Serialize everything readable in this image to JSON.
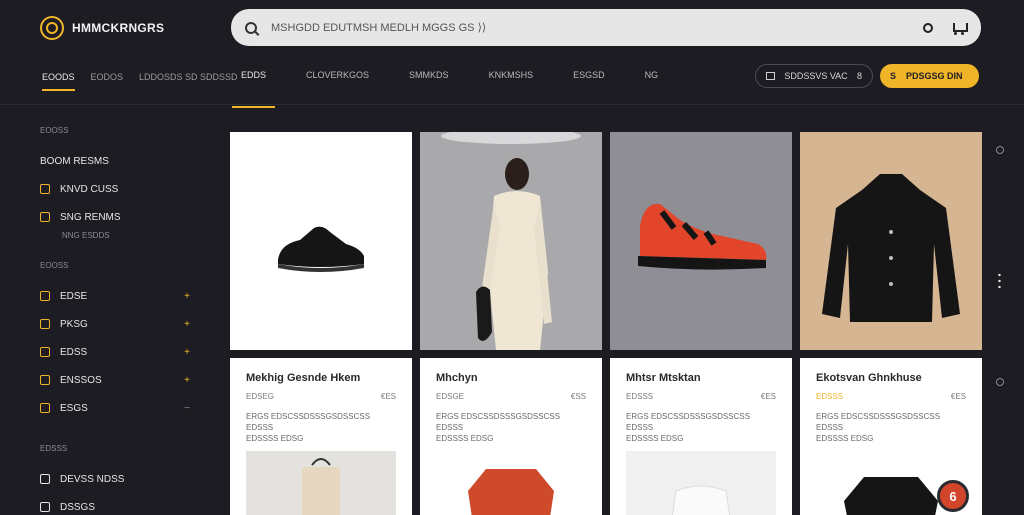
{
  "app": {
    "logo_text": "HMMCKRNGRS"
  },
  "search": {
    "placeholder": "MSHGDD EDUTMSH MEDLH MGGS GS ⟩⟩"
  },
  "left_tabs": [
    "EOODS",
    "EODOS",
    "LDDOSDS SD SDDSSD"
  ],
  "main_tabs": [
    "EDDS",
    "CLOVERKGOS",
    "SMMKDS",
    "KNKMSHS",
    "ESGSD",
    "NG"
  ],
  "filter": {
    "label": "SDDSSVS VAC",
    "count": "8"
  },
  "cta": {
    "icon": "S",
    "label": "PDSGSG DIN"
  },
  "sidebar": {
    "section1": "EOOSS",
    "heading": "BOOM RESMS",
    "items1": [
      {
        "label": "KNVD CUSS"
      },
      {
        "label": "SNG RENMS",
        "sub": "NNG ESDDS"
      }
    ],
    "section2": "EOOSS",
    "items2": [
      {
        "label": "EDSE"
      },
      {
        "label": "PKSG"
      },
      {
        "label": "EDSS"
      },
      {
        "label": "ENSSOS"
      },
      {
        "label": "ESGS"
      }
    ],
    "section3": "EDSSS",
    "items3": [
      {
        "label": "DEVSS  NDSS"
      },
      {
        "label": "DSSGS"
      }
    ]
  },
  "products": [
    {
      "title": "Mekhig Gesnde Hkem",
      "meta_left": "EDSEG",
      "meta_right": "€ES",
      "desc": [
        "ERGS EDSCSSDSSSGSDSSCSS EDSSS",
        "EDSSSS EDSG"
      ]
    },
    {
      "title": "Mhchyn",
      "meta_left": "EDSGE",
      "meta_right": "€SS",
      "desc": [
        "ERGS EDSCSSDSSSGSDSSCSS EDSSS",
        "EDSSSS EDSG"
      ]
    },
    {
      "title": "Mhtsr Mtsktan",
      "meta_left": "EDSSS",
      "meta_right": "€ES",
      "desc": [
        "ERGS EDSCSSDSSSGSDSSCSS EDSSS",
        "EDSSSS EDSG"
      ]
    },
    {
      "title": "Ekotsvan Ghnkhuse",
      "meta_left": "EDSSS",
      "meta_right": "€ES",
      "desc": [
        "ERGS EDSCSSDSSSGSDSSCSS EDSSS",
        "EDSSSS EDSG"
      ]
    }
  ],
  "badge": "6",
  "colors": {
    "accent": "#f0b429",
    "bg": "#1c1c22",
    "card": "#ffffff"
  },
  "icons": [
    "search-icon",
    "user-icon",
    "cart-icon",
    "grid-icon",
    "settings-icon"
  ]
}
